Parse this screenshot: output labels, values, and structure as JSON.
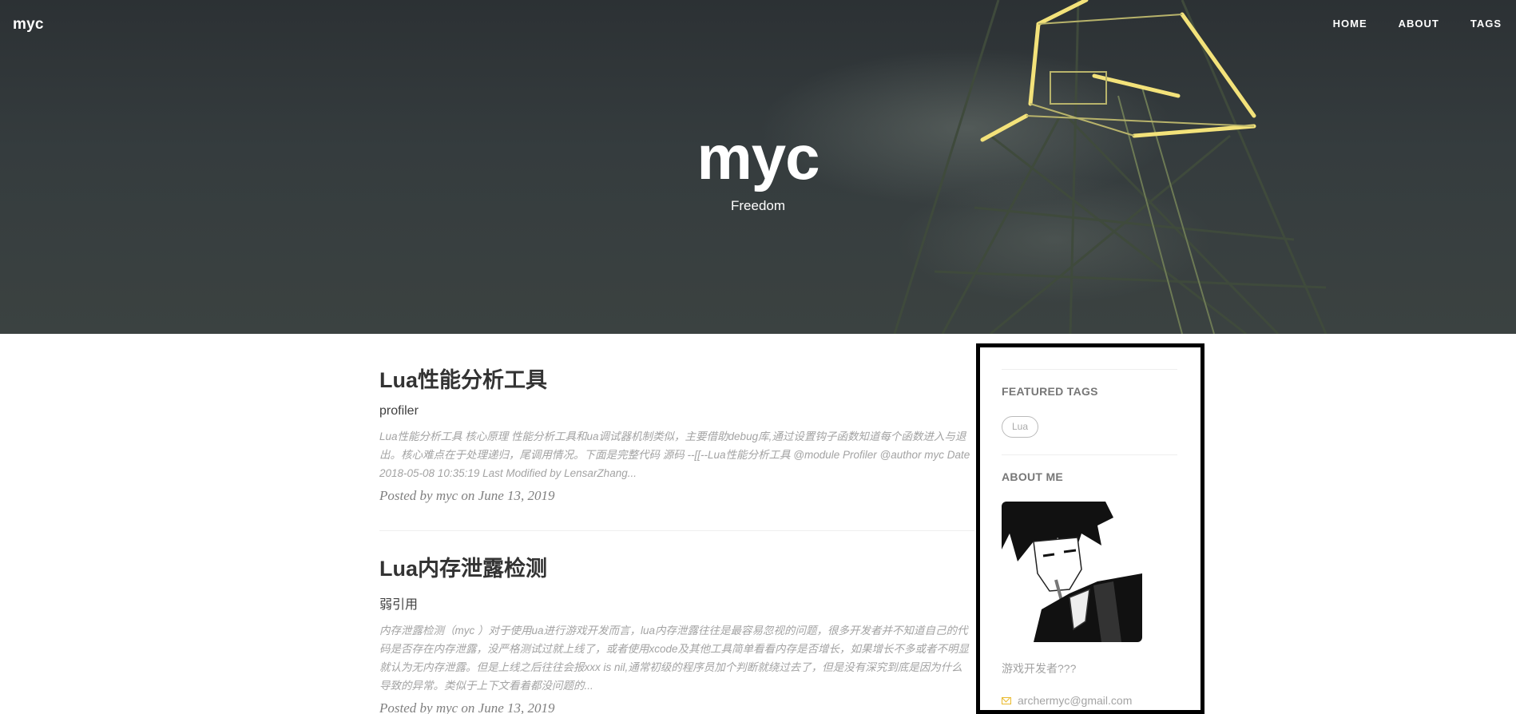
{
  "header": {
    "brand": "myc",
    "nav": [
      {
        "label": "HOME"
      },
      {
        "label": "ABOUT"
      },
      {
        "label": "TAGS"
      }
    ],
    "title": "myc",
    "subtitle": "Freedom"
  },
  "posts": [
    {
      "title": "Lua性能分析工具",
      "subtitle": "profiler",
      "excerpt": "Lua性能分析工具 核心原理 性能分析工具和ua调试器机制类似，主要借助debug库,通过设置钩子函数知道每个函数进入与退出。核心难点在于处理递归，尾调用情况。下面是完整代码 源码 --[[--Lua性能分析工具 @module Profiler @author myc Date 2018-05-08 10:35:19 Last Modified by LensarZhang...",
      "meta": "Posted by myc on June 13, 2019"
    },
    {
      "title": "Lua内存泄露检测",
      "subtitle": "弱引用",
      "excerpt": "内存泄露检测（myc ）对于使用ua进行游戏开发而言，lua内存泄露往往是最容易忽视的问题，很多开发者并不知道自己的代码是否存在内存泄露，没严格测试过就上线了，或者使用xcode及其他工具简单看看内存是否增长，如果增长不多或者不明显就认为无内存泄露。但是上线之后往往会报xxx is nil,通常初级的程序员加个判断就绕过去了，但是没有深究到底是因为什么导致的异常。类似于上下文看着都没问题的...",
      "meta": "Posted by myc on June 13, 2019"
    }
  ],
  "sidebar": {
    "featured_tags_heading": "FEATURED TAGS",
    "tags": [
      "Lua"
    ],
    "about_heading": "ABOUT ME",
    "about_text": "游戏开发者???",
    "email": "archermyc@gmail.com"
  },
  "colors": {
    "hero_bg": "#30373a",
    "tower_light": "#f3e27a",
    "sidebar_border": "#000000",
    "mail_icon": "#e9b92b"
  }
}
